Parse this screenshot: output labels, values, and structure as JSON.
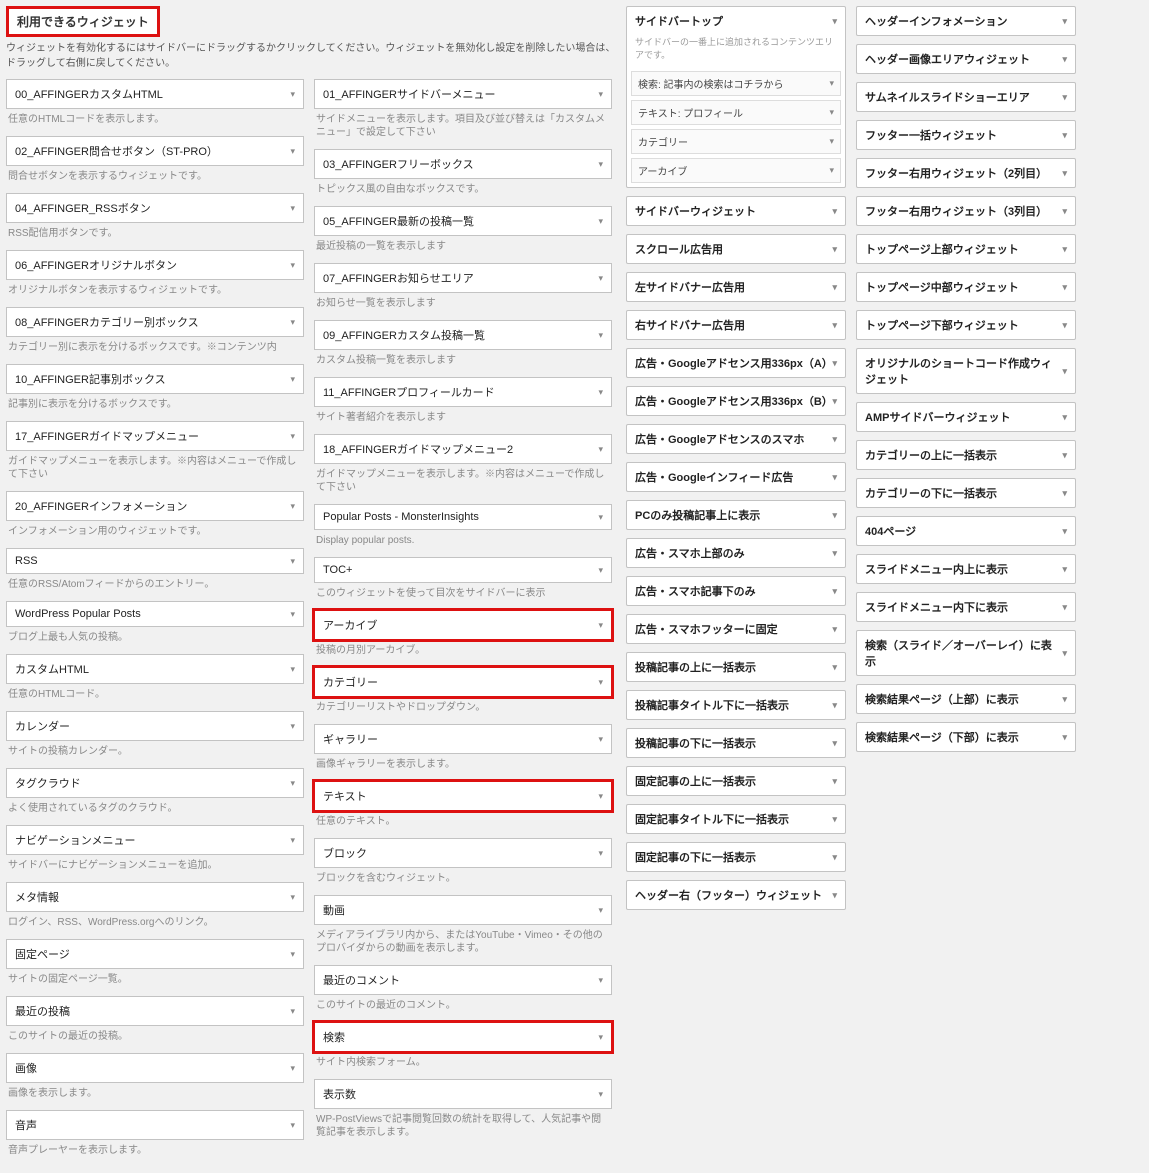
{
  "header": {
    "title": "利用できるウィジェット",
    "subtitle": "ウィジェットを有効化するにはサイドバーにドラッグするかクリックしてください。ウィジェットを無効化し設定を削除したい場合は、ドラッグして右側に戻してください。"
  },
  "available_left": [
    {
      "title": "00_AFFINGERカスタムHTML",
      "desc": "任意のHTMLコードを表示します。"
    },
    {
      "title": "02_AFFINGER問合せボタン（ST-PRO）",
      "desc": "問合せボタンを表示するウィジェットです。"
    },
    {
      "title": "04_AFFINGER_RSSボタン",
      "desc": "RSS配信用ボタンです。"
    },
    {
      "title": "06_AFFINGERオリジナルボタン",
      "desc": "オリジナルボタンを表示するウィジェットです。"
    },
    {
      "title": "08_AFFINGERカテゴリー別ボックス",
      "desc": "カテゴリー別に表示を分けるボックスです。※コンテンツ内"
    },
    {
      "title": "10_AFFINGER記事別ボックス",
      "desc": "記事別に表示を分けるボックスです。"
    },
    {
      "title": "17_AFFINGERガイドマップメニュー",
      "desc": "ガイドマップメニューを表示します。※内容はメニューで作成して下さい"
    },
    {
      "title": "20_AFFINGERインフォメーション",
      "desc": "インフォメーション用のウィジェットです。"
    },
    {
      "title": "RSS",
      "desc": "任意のRSS/Atomフィードからのエントリー。"
    },
    {
      "title": "WordPress Popular Posts",
      "desc": "ブログ上最も人気の投稿。"
    },
    {
      "title": "カスタムHTML",
      "desc": "任意のHTMLコード。"
    },
    {
      "title": "カレンダー",
      "desc": "サイトの投稿カレンダー。"
    },
    {
      "title": "タグクラウド",
      "desc": "よく使用されているタグのクラウド。"
    },
    {
      "title": "ナビゲーションメニュー",
      "desc": "サイドバーにナビゲーションメニューを追加。"
    },
    {
      "title": "メタ情報",
      "desc": "ログイン、RSS、WordPress.orgへのリンク。"
    },
    {
      "title": "固定ページ",
      "desc": "サイトの固定ページ一覧。"
    },
    {
      "title": "最近の投稿",
      "desc": "このサイトの最近の投稿。"
    },
    {
      "title": "画像",
      "desc": "画像を表示します。"
    },
    {
      "title": "音声",
      "desc": "音声プレーヤーを表示します。"
    }
  ],
  "available_right": [
    {
      "title": "01_AFFINGERサイドバーメニュー",
      "desc": "サイドメニューを表示します。項目及び並び替えは「カスタムメニュー」で設定して下さい"
    },
    {
      "title": "03_AFFINGERフリーボックス",
      "desc": "トピックス風の自由なボックスです。"
    },
    {
      "title": "05_AFFINGER最新の投稿一覧",
      "desc": "最近投稿の一覧を表示します"
    },
    {
      "title": "07_AFFINGERお知らせエリア",
      "desc": "お知らせ一覧を表示します"
    },
    {
      "title": "09_AFFINGERカスタム投稿一覧",
      "desc": "カスタム投稿一覧を表示します"
    },
    {
      "title": "11_AFFINGERプロフィールカード",
      "desc": "サイト著者紹介を表示します"
    },
    {
      "title": "18_AFFINGERガイドマップメニュー2",
      "desc": "ガイドマップメニューを表示します。※内容はメニューで作成して下さい"
    },
    {
      "title": "Popular Posts - MonsterInsights",
      "desc": "Display popular posts."
    },
    {
      "title": "TOC+",
      "desc": "このウィジェットを使って目次をサイドバーに表示"
    },
    {
      "title": "アーカイブ",
      "desc": "投稿の月別アーカイブ。",
      "hl": true
    },
    {
      "title": "カテゴリー",
      "desc": "カテゴリーリストやドロップダウン。",
      "hl": true
    },
    {
      "title": "ギャラリー",
      "desc": "画像ギャラリーを表示します。"
    },
    {
      "title": "テキスト",
      "desc": "任意のテキスト。",
      "hl": true
    },
    {
      "title": "ブロック",
      "desc": "ブロックを含むウィジェット。"
    },
    {
      "title": "動画",
      "desc": "メディアライブラリ内から、またはYouTube・Vimeo・その他のプロバイダからの動画を表示します。"
    },
    {
      "title": "最近のコメント",
      "desc": "このサイトの最近のコメント。"
    },
    {
      "title": "検索",
      "desc": "サイト内検索フォーム。",
      "hl": true
    },
    {
      "title": "表示数",
      "desc": "WP-PostViewsで記事閲覧回数の統計を取得して、人気記事や閲覧記事を表示します。"
    }
  ],
  "areas_col1": [
    {
      "title": "サイドバートップ",
      "sub": "サイドバーの一番上に追加されるコンテンツエリアです。",
      "items": [
        {
          "label": "検索: 記事内の検索はコチラから"
        },
        {
          "label": "テキスト: プロフィール"
        },
        {
          "label": "カテゴリー"
        },
        {
          "label": "アーカイブ"
        }
      ]
    },
    {
      "title": "サイドバーウィジェット"
    },
    {
      "title": "スクロール広告用"
    },
    {
      "title": "左サイドバナー広告用"
    },
    {
      "title": "右サイドバナー広告用"
    },
    {
      "title": "広告・Googleアドセンス用336px（A）"
    },
    {
      "title": "広告・Googleアドセンス用336px（B）"
    },
    {
      "title": "広告・Googleアドセンスのスマホ"
    },
    {
      "title": "広告・Googleインフィード広告"
    },
    {
      "title": "PCのみ投稿記事上に表示"
    },
    {
      "title": "広告・スマホ上部のみ"
    },
    {
      "title": "広告・スマホ記事下のみ"
    },
    {
      "title": "広告・スマホフッターに固定"
    },
    {
      "title": "投稿記事の上に一括表示"
    },
    {
      "title": "投稿記事タイトル下に一括表示"
    },
    {
      "title": "投稿記事の下に一括表示"
    },
    {
      "title": "固定記事の上に一括表示"
    },
    {
      "title": "固定記事タイトル下に一括表示"
    },
    {
      "title": "固定記事の下に一括表示"
    },
    {
      "title": "ヘッダー右（フッター）ウィジェット"
    }
  ],
  "areas_col2": [
    {
      "title": "ヘッダーインフォメーション"
    },
    {
      "title": "ヘッダー画像エリアウィジェット"
    },
    {
      "title": "サムネイルスライドショーエリア"
    },
    {
      "title": "フッター一括ウィジェット"
    },
    {
      "title": "フッター右用ウィジェット（2列目）"
    },
    {
      "title": "フッター右用ウィジェット（3列目）"
    },
    {
      "title": "トップページ上部ウィジェット"
    },
    {
      "title": "トップページ中部ウィジェット"
    },
    {
      "title": "トップページ下部ウィジェット"
    },
    {
      "title": "オリジナルのショートコード作成ウィジェット"
    },
    {
      "title": "AMPサイドバーウィジェット"
    },
    {
      "title": "カテゴリーの上に一括表示"
    },
    {
      "title": "カテゴリーの下に一括表示"
    },
    {
      "title": "404ページ"
    },
    {
      "title": "スライドメニュー内上に表示"
    },
    {
      "title": "スライドメニュー内下に表示"
    },
    {
      "title": "検索（スライド／オーバーレイ）に表示"
    },
    {
      "title": "検索結果ページ（上部）に表示"
    },
    {
      "title": "検索結果ページ（下部）に表示"
    }
  ]
}
